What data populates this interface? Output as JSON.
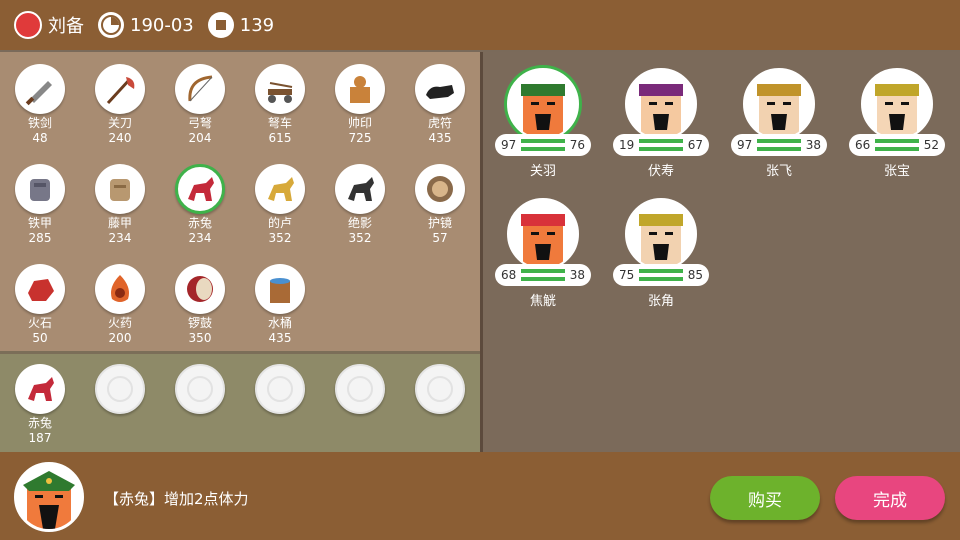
{
  "topbar": {
    "lord": "刘备",
    "date": "190-03",
    "gold": "139",
    "faction_color": "#e03a3a"
  },
  "shop_items": [
    {
      "name": "铁剑",
      "price": "48",
      "icon": "iron-sword-icon"
    },
    {
      "name": "关刀",
      "price": "240",
      "icon": "guan-dao-icon"
    },
    {
      "name": "弓弩",
      "price": "204",
      "icon": "bow-icon"
    },
    {
      "name": "弩车",
      "price": "615",
      "icon": "ballista-icon"
    },
    {
      "name": "帅印",
      "price": "725",
      "icon": "seal-icon"
    },
    {
      "name": "虎符",
      "price": "435",
      "icon": "tiger-tally-icon"
    },
    {
      "name": "铁甲",
      "price": "285",
      "icon": "iron-armor-icon"
    },
    {
      "name": "藤甲",
      "price": "234",
      "icon": "rattan-armor-icon"
    },
    {
      "name": "赤兔",
      "price": "234",
      "icon": "red-hare-horse-icon",
      "selected": true
    },
    {
      "name": "的卢",
      "price": "352",
      "icon": "dilu-horse-icon"
    },
    {
      "name": "绝影",
      "price": "352",
      "icon": "jueying-horse-icon"
    },
    {
      "name": "护镜",
      "price": "57",
      "icon": "mirror-shield-icon"
    },
    {
      "name": "火石",
      "price": "50",
      "icon": "fire-stone-icon"
    },
    {
      "name": "火药",
      "price": "200",
      "icon": "gunpowder-icon"
    },
    {
      "name": "锣鼓",
      "price": "350",
      "icon": "drum-icon"
    },
    {
      "name": "水桶",
      "price": "435",
      "icon": "water-bucket-icon"
    }
  ],
  "owned_items": [
    {
      "name": "赤兔",
      "price": "187",
      "icon": "red-hare-horse-icon"
    }
  ],
  "empty_slots": 5,
  "heroes": [
    {
      "name": "关羽",
      "left": "97",
      "right": "76",
      "selected": true
    },
    {
      "name": "伏寿",
      "left": "19",
      "right": "67"
    },
    {
      "name": "张飞",
      "left": "97",
      "right": "38"
    },
    {
      "name": "张宝",
      "left": "66",
      "right": "52"
    },
    {
      "name": "焦觥",
      "left": "68",
      "right": "38"
    },
    {
      "name": "张角",
      "left": "75",
      "right": "85"
    }
  ],
  "bottom": {
    "description": "【赤兔】增加2点体力",
    "buy_label": "购买",
    "done_label": "完成"
  }
}
